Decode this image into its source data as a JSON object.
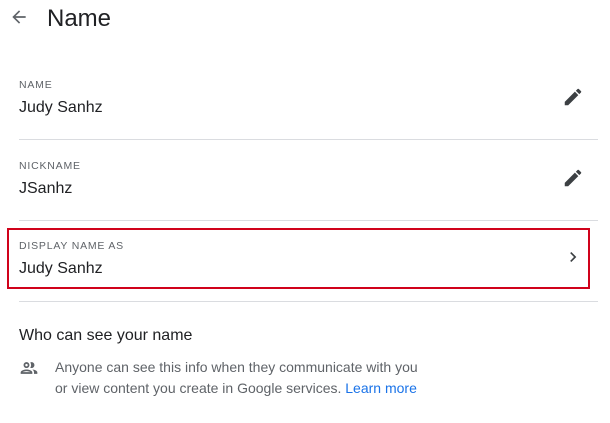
{
  "header": {
    "title": "Name",
    "back_icon": "arrow-left-icon"
  },
  "rows": [
    {
      "label": "NAME",
      "value": "Judy Sanhz",
      "action_icon": "pencil-icon"
    },
    {
      "label": "NICKNAME",
      "value": "JSanhz",
      "action_icon": "pencil-icon"
    },
    {
      "label": "DISPLAY NAME AS",
      "value": "Judy Sanhz",
      "action_icon": "chevron-right-icon"
    }
  ],
  "visibility": {
    "title": "Who can see your name",
    "icon": "people-icon",
    "description": "Anyone can see this info when they communicate with you or view content you create in Google services.",
    "link_text": "Learn more"
  },
  "colors": {
    "highlight_border": "#d0021b",
    "link": "#1a73e8",
    "divider": "#dadce0"
  }
}
